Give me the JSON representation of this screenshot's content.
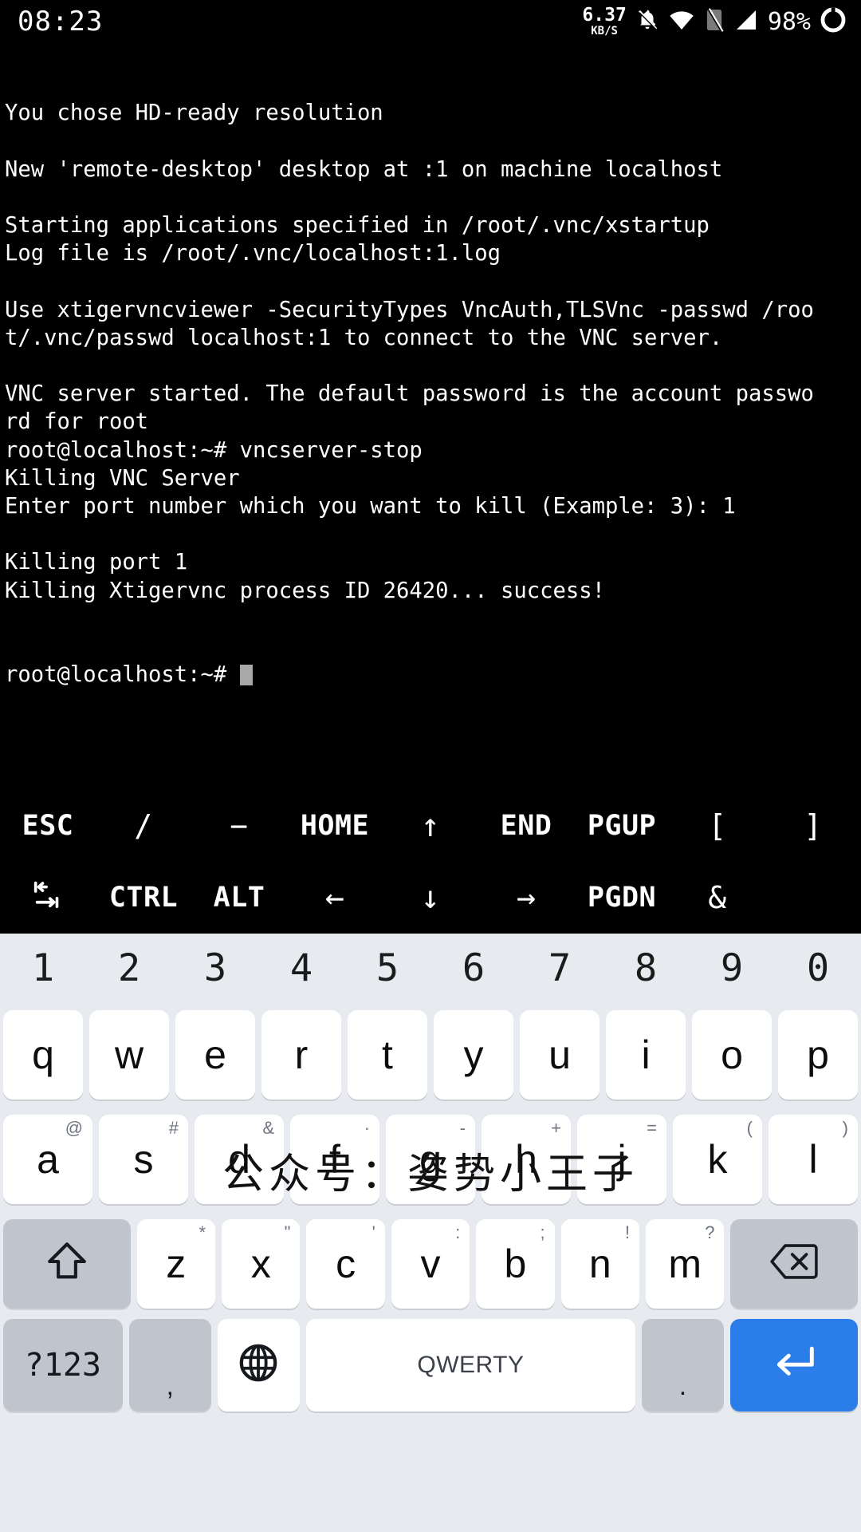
{
  "statusbar": {
    "clock": "08:23",
    "net_rate": "6.37",
    "net_unit": "KB/S",
    "battery_percent": "98%",
    "icons": [
      "notifications-off-icon",
      "wifi-icon",
      "sim-card-off-icon",
      "signal-icon",
      "battery-icon"
    ]
  },
  "terminal": {
    "lines": [
      "You chose HD-ready resolution",
      "",
      "New 'remote-desktop' desktop at :1 on machine localhost",
      "",
      "Starting applications specified in /root/.vnc/xstartup",
      "Log file is /root/.vnc/localhost:1.log",
      "",
      "Use xtigervncviewer -SecurityTypes VncAuth,TLSVnc -passwd /roo",
      "t/.vnc/passwd localhost:1 to connect to the VNC server.",
      "",
      "VNC server started. The default password is the account passwo",
      "rd for root",
      "root@localhost:~# vncserver-stop",
      "Killing VNC Server",
      "Enter port number which you want to kill (Example: 3): 1",
      "",
      "Killing port 1",
      "Killing Xtigervnc process ID 26420... success!"
    ],
    "prompt": "root@localhost:~# ",
    "foreground": "#ffffff",
    "background": "#000000"
  },
  "extra_keys": {
    "row1": [
      {
        "label": "ESC",
        "name": "extra-key-esc",
        "kind": "text"
      },
      {
        "label": "/",
        "name": "extra-key-slash",
        "kind": "sym"
      },
      {
        "label": "−",
        "name": "extra-key-minus",
        "kind": "sym"
      },
      {
        "label": "HOME",
        "name": "extra-key-home",
        "kind": "text"
      },
      {
        "label": "↑",
        "name": "extra-key-arrow-up",
        "kind": "arrow"
      },
      {
        "label": "END",
        "name": "extra-key-end",
        "kind": "text"
      },
      {
        "label": "PGUP",
        "name": "extra-key-pgup",
        "kind": "text"
      },
      {
        "label": "[",
        "name": "extra-key-bracket-left",
        "kind": "sym"
      },
      {
        "label": "]",
        "name": "extra-key-bracket-right",
        "kind": "sym"
      }
    ],
    "row2": [
      {
        "label": "",
        "name": "extra-key-tab-icon",
        "kind": "tabicon"
      },
      {
        "label": "CTRL",
        "name": "extra-key-ctrl",
        "kind": "text"
      },
      {
        "label": "ALT",
        "name": "extra-key-alt",
        "kind": "text"
      },
      {
        "label": "←",
        "name": "extra-key-arrow-left",
        "kind": "arrow"
      },
      {
        "label": "↓",
        "name": "extra-key-arrow-down",
        "kind": "arrow"
      },
      {
        "label": "→",
        "name": "extra-key-arrow-right",
        "kind": "arrow"
      },
      {
        "label": "PGDN",
        "name": "extra-key-pgdn",
        "kind": "text"
      },
      {
        "label": "&",
        "name": "extra-key-ampersand",
        "kind": "sym"
      },
      {
        "label": "",
        "name": "extra-key-empty",
        "kind": "text"
      }
    ]
  },
  "keyboard": {
    "numbers": [
      "1",
      "2",
      "3",
      "4",
      "5",
      "6",
      "7",
      "8",
      "9",
      "0"
    ],
    "row_q": [
      {
        "main": "q",
        "sup": ""
      },
      {
        "main": "w",
        "sup": ""
      },
      {
        "main": "e",
        "sup": ""
      },
      {
        "main": "r",
        "sup": ""
      },
      {
        "main": "t",
        "sup": ""
      },
      {
        "main": "y",
        "sup": ""
      },
      {
        "main": "u",
        "sup": ""
      },
      {
        "main": "i",
        "sup": ""
      },
      {
        "main": "o",
        "sup": ""
      },
      {
        "main": "p",
        "sup": ""
      }
    ],
    "row_a": [
      {
        "main": "a",
        "sup": "@"
      },
      {
        "main": "s",
        "sup": "#"
      },
      {
        "main": "d",
        "sup": "&"
      },
      {
        "main": "f",
        "sup": "·"
      },
      {
        "main": "g",
        "sup": "-"
      },
      {
        "main": "h",
        "sup": "+"
      },
      {
        "main": "j",
        "sup": "="
      },
      {
        "main": "k",
        "sup": "("
      },
      {
        "main": "l",
        "sup": ")"
      }
    ],
    "row_z": [
      {
        "main": "z",
        "sup": "*"
      },
      {
        "main": "x",
        "sup": "\""
      },
      {
        "main": "c",
        "sup": "'"
      },
      {
        "main": "v",
        "sup": ":"
      },
      {
        "main": "b",
        "sup": ";"
      },
      {
        "main": "n",
        "sup": "!"
      },
      {
        "main": "m",
        "sup": "?"
      }
    ],
    "shift_key": "shift-icon",
    "backspace_key": "backspace-icon",
    "bottom": {
      "symbols_label": "?123",
      "comma_label": ",",
      "globe_label": "globe-icon",
      "space_label": "QWERTY",
      "period_label": ".",
      "enter_label": "enter-icon"
    },
    "colors": {
      "background": "#e7eaef",
      "key": "#ffffff",
      "modifier_key": "#bfc4cd",
      "enter_key": "#2b7de9",
      "text": "#0d0d0d",
      "sup_text": "#6e7480"
    }
  },
  "watermark": {
    "text": "公众号：姿势小王子"
  }
}
